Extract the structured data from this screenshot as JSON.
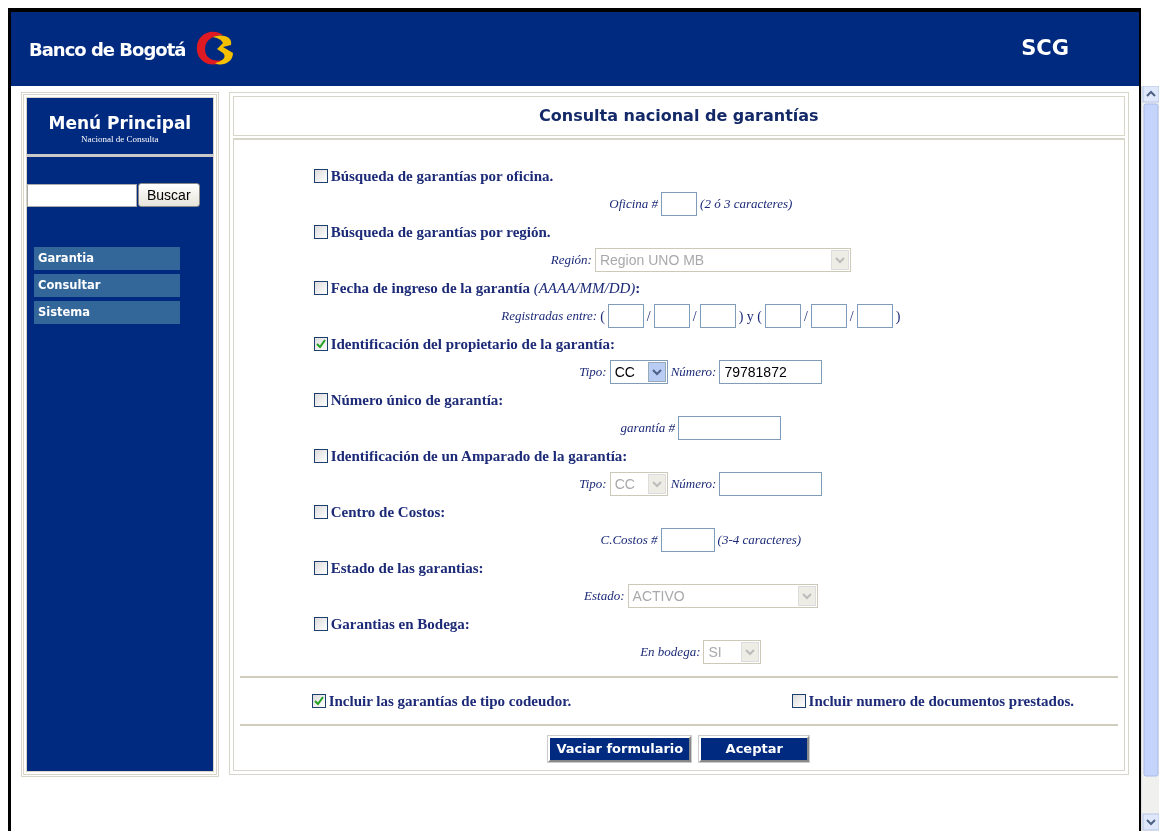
{
  "header": {
    "brand": "Banco de Bogotá",
    "app": "SCG"
  },
  "sidebar": {
    "title": "Menú Principal",
    "subtitle": "Nacional de Consulta",
    "search_button": "Buscar",
    "items": [
      {
        "label": "Garantia"
      },
      {
        "label": "Consultar"
      },
      {
        "label": "Sistema"
      }
    ]
  },
  "page_title": "Consulta nacional de garantías",
  "sections": [
    {
      "label": "Búsqueda de garantías por oficina.",
      "checked": false,
      "fields": [
        {
          "kind": "label",
          "text": "Oficina #"
        },
        {
          "kind": "box"
        },
        {
          "kind": "note",
          "text": "(2 ó 3 caracteres)"
        }
      ]
    },
    {
      "label": "Búsqueda de garantías por región.",
      "checked": false,
      "fields": [
        {
          "kind": "label",
          "text": "Región:"
        },
        {
          "kind": "longlist",
          "value": "Region UNO MB",
          "disabled": true
        }
      ]
    },
    {
      "label": "Fecha de ingreso de la garantía *(AAAA/MM/DD)*:",
      "checked": false,
      "fields": [
        {
          "kind": "label",
          "text": "Registradas entre:"
        },
        {
          "kind": "sep",
          "text": "("
        },
        {
          "kind": "box"
        },
        {
          "kind": "sep",
          "text": "/"
        },
        {
          "kind": "box"
        },
        {
          "kind": "sep",
          "text": "/"
        },
        {
          "kind": "box"
        },
        {
          "kind": "sep",
          "text": ") y ("
        },
        {
          "kind": "box"
        },
        {
          "kind": "sep",
          "text": "/"
        },
        {
          "kind": "box"
        },
        {
          "kind": "sep",
          "text": "/"
        },
        {
          "kind": "box"
        },
        {
          "kind": "sep",
          "text": ")"
        }
      ]
    },
    {
      "label": "Identificación del propietario de la garantía:",
      "checked": true,
      "fields": [
        {
          "kind": "label",
          "text": "Tipo:"
        },
        {
          "kind": "select",
          "value": "CC",
          "disabled": false
        },
        {
          "kind": "label",
          "text": "Número:"
        },
        {
          "kind": "field",
          "value": "79781872"
        }
      ]
    },
    {
      "label": "Número único de garantía:",
      "checked": false,
      "fields": [
        {
          "kind": "label",
          "text": "garantía #"
        },
        {
          "kind": "field"
        }
      ]
    },
    {
      "label": "Identificación de un Amparado de la garantía:",
      "checked": false,
      "fields": [
        {
          "kind": "label",
          "text": "Tipo:"
        },
        {
          "kind": "select",
          "value": "CC",
          "disabled": true
        },
        {
          "kind": "label",
          "text": "Número:"
        },
        {
          "kind": "field"
        }
      ]
    },
    {
      "label": "Centro de Costos:",
      "checked": false,
      "fields": [
        {
          "kind": "label",
          "text": "C.Costos #"
        },
        {
          "kind": "midbox"
        },
        {
          "kind": "note",
          "text": "(3-4 caracteres)"
        }
      ]
    },
    {
      "label": "Estado de las garantias:",
      "checked": false,
      "fields": [
        {
          "kind": "label",
          "text": "Estado:"
        },
        {
          "kind": "list",
          "value": "ACTIVO",
          "disabled": true
        }
      ]
    },
    {
      "label": "Garantias en Bodega:",
      "checked": false,
      "fields": [
        {
          "kind": "label",
          "text": "En bodega:"
        },
        {
          "kind": "select",
          "value": "SI",
          "disabled": true
        }
      ]
    }
  ],
  "options": [
    {
      "label": "Incluir las garantías de tipo codeudor.",
      "checked": true
    },
    {
      "label": "Incluir numero de documentos prestados.",
      "checked": false
    }
  ],
  "buttons": [
    "Vaciar formulario",
    "Aceptar"
  ]
}
